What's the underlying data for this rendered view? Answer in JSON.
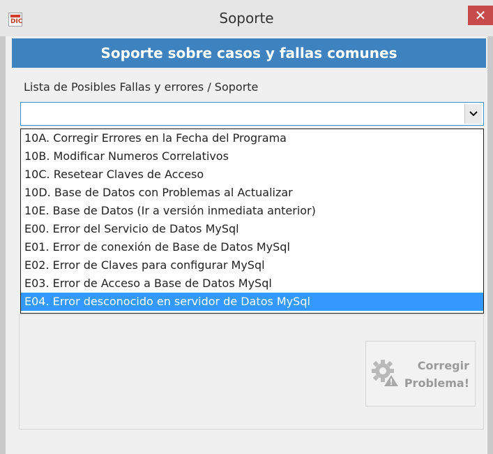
{
  "window": {
    "title": "Soporte",
    "app_icon_text": "DIC",
    "close_glyph": "✕"
  },
  "header": {
    "title": "Soporte sobre casos y fallas comunes"
  },
  "form": {
    "list_label": "Lista de Posibles Fallas y errores / Soporte",
    "combo_value": "",
    "combo_arrow": "⌄",
    "options": [
      "10A. Corregir Errores en la Fecha del Programa",
      "10B. Modificar Numeros Correlativos",
      "10C. Resetear Claves de Acceso",
      "10D. Base de Datos con Problemas al Actualizar",
      "10E. Base de Datos (Ir a versión inmediata anterior)",
      "E00. Error del Servicio de Datos MySql",
      "E01. Error de conexión de Base de Datos MySql",
      "E02. Error de Claves para configurar MySql",
      "E03. Error de Acceso a Base de Datos MySql",
      "E04. Error desconocido en servidor de Datos MySql"
    ],
    "selected_index": 9
  },
  "actions": {
    "fix_line1": "Corregir",
    "fix_line2": "Problema!",
    "fix_icon": "gear-warning-icon"
  },
  "colors": {
    "header_bg": "#3e82bf",
    "selection_bg": "#3399ff",
    "close_bg": "#c74b4b"
  }
}
